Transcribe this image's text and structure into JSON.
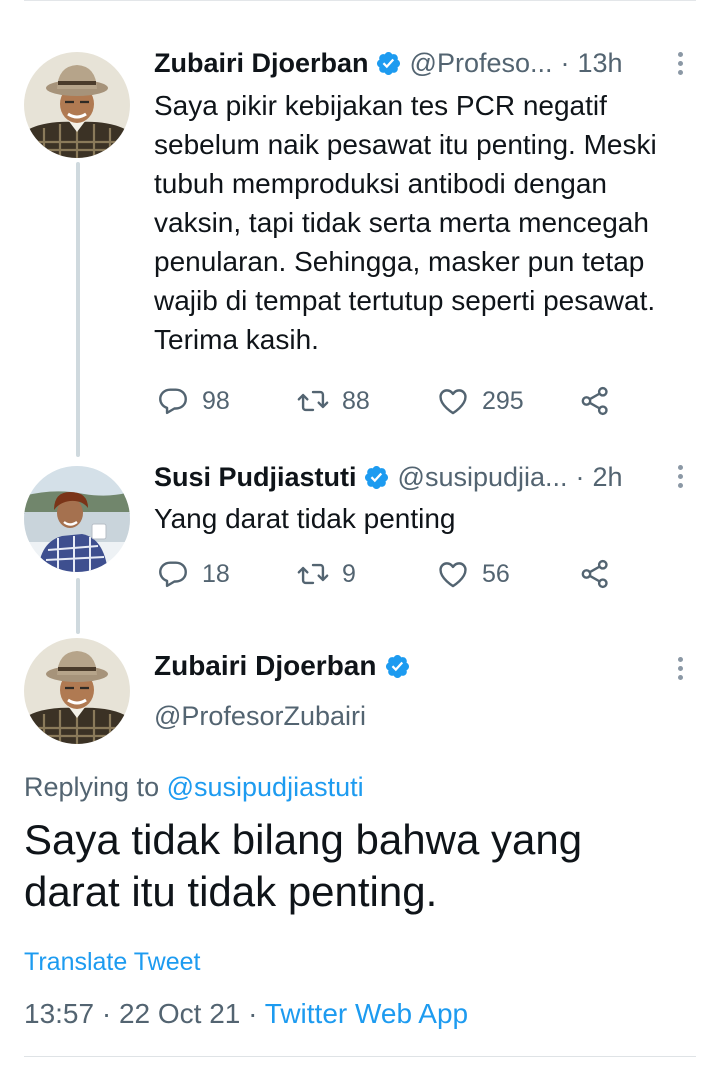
{
  "thread": [
    {
      "name": "Zubairi Djoerban",
      "handle": "@Profeso...",
      "separator": "·",
      "time": "13h",
      "text": "Saya pikir kebijakan tes PCR negatif sebelum naik pesawat itu penting. Meski tubuh memproduksi antibodi dengan vaksin, tapi tidak serta merta mencegah penularan. Sehingga, masker pun tetap wajib di tempat tertutup seperti pesawat. Terima kasih.",
      "replies": "98",
      "retweets": "88",
      "likes": "295"
    },
    {
      "name": "Susi Pudjiastuti",
      "handle": "@susipudjia...",
      "separator": "·",
      "time": "2h",
      "text": "Yang darat tidak penting",
      "replies": "18",
      "retweets": "9",
      "likes": "56"
    }
  ],
  "main_tweet": {
    "name": "Zubairi Djoerban",
    "handle": "@ProfesorZubairi",
    "replying_prefix": "Replying to ",
    "replying_handle": "@susipudjiastuti",
    "text": "Saya tidak bilang bahwa yang darat itu tidak penting.",
    "translate_label": "Translate Tweet",
    "time": "13:57",
    "separator": "·",
    "date": "22 Oct 21",
    "source": "Twitter Web App"
  },
  "colors": {
    "accent": "#1d9bf0",
    "secondary_text": "#536471",
    "thread_line": "#cfd9de"
  },
  "icons": [
    "verified-badge-icon",
    "more-icon",
    "reply-icon",
    "retweet-icon",
    "like-icon",
    "share-icon"
  ]
}
